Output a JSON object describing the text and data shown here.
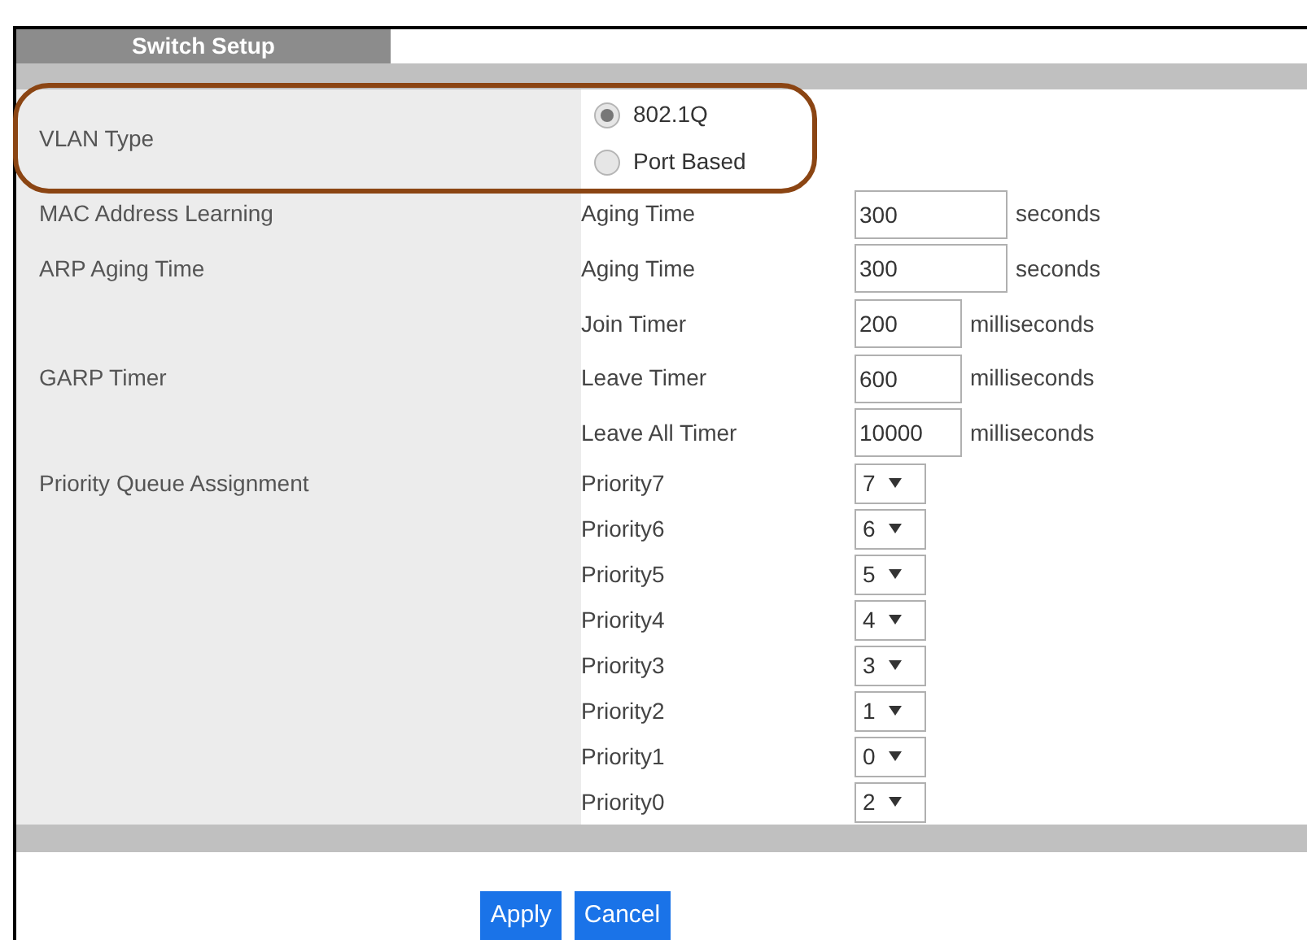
{
  "tab": {
    "label": "Switch Setup",
    "selected": true
  },
  "sections": [
    {
      "label": "VLAN Type",
      "rows": [
        {
          "kind": "radio",
          "label": "802.1Q",
          "selected": true
        },
        {
          "kind": "radio",
          "label": "Port Based",
          "selected": false
        }
      ]
    },
    {
      "label": "MAC Address Learning",
      "rows": [
        {
          "kind": "input",
          "label": "Aging Time",
          "value": "300",
          "unit": "seconds"
        }
      ]
    },
    {
      "label": "ARP Aging Time",
      "rows": [
        {
          "kind": "input",
          "label": "Aging Time",
          "value": "300",
          "unit": "seconds"
        }
      ]
    },
    {
      "label": "GARP Timer",
      "rows": [
        {
          "kind": "timer",
          "label": "Join Timer",
          "value": "200",
          "unit": "milliseconds"
        },
        {
          "kind": "timer",
          "label": "Leave Timer",
          "value": "600",
          "unit": "milliseconds"
        },
        {
          "kind": "timer",
          "label": "Leave All Timer",
          "value": "10000",
          "unit": "milliseconds"
        }
      ]
    },
    {
      "label": "Priority Queue Assignment",
      "rows": [
        {
          "kind": "select",
          "label": "Priority7",
          "value": "7"
        },
        {
          "kind": "select",
          "label": "Priority6",
          "value": "6"
        },
        {
          "kind": "select",
          "label": "Priority5",
          "value": "5"
        },
        {
          "kind": "select",
          "label": "Priority4",
          "value": "4"
        },
        {
          "kind": "select",
          "label": "Priority3",
          "value": "3"
        },
        {
          "kind": "select",
          "label": "Priority2",
          "value": "1"
        },
        {
          "kind": "select",
          "label": "Priority1",
          "value": "0"
        },
        {
          "kind": "select",
          "label": "Priority0",
          "value": "2"
        }
      ]
    }
  ],
  "buttons": [
    "Apply",
    "Cancel"
  ]
}
